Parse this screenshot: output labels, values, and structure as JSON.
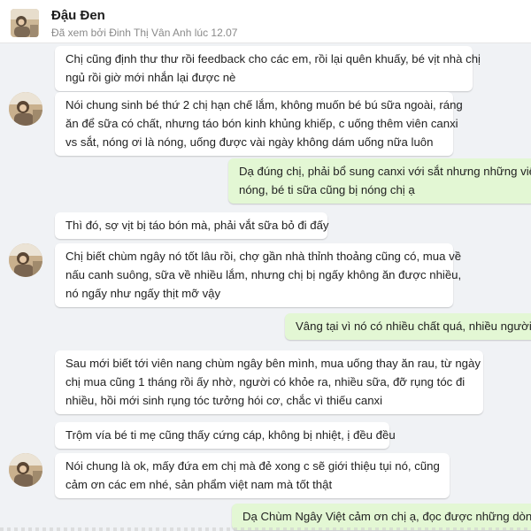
{
  "header": {
    "contact_name": "Đậu Đen",
    "seen_status": "Đã xem bởi Đinh Thị Vân Anh lúc 12.07"
  },
  "messages": [
    {
      "side": "in",
      "lines": [
        "Chị cũng định thư thư rồi feedback cho các em, rồi lại quên khuấy, bé vịt nhà chị",
        "ngủ rồi giờ mới nhắn lại được nè"
      ]
    },
    {
      "side": "in",
      "lines": [
        "Nói chung sinh bé thứ 2 chị hạn chế lắm, không muốn bé bú sữa ngoài, ráng",
        "ăn để sữa có chất, nhưng táo bón kinh khủng khiếp, c uống thêm viên canxi",
        "vs sắt, nóng ơi là nóng, uống được vài ngày không dám uống nữa luôn"
      ]
    },
    {
      "side": "out",
      "lines": [
        "Dạ đúng chị, phải bổ sung canxi với sắt nhưng những viên t",
        "nóng, bé ti sữa cũng bị nóng chị ạ"
      ]
    },
    {
      "side": "in",
      "lines": [
        "Thì đó, sợ vịt bị táo bón mà, phải vắt sữa bỏ đi đấy"
      ]
    },
    {
      "side": "in",
      "lines": [
        "Chị biết chùm ngây nó tốt lâu rồi, chợ gần nhà thỉnh thoảng cũng có, mua về",
        "nấu canh suông, sữa về nhiều lắm, nhưng chị bị ngấy không ăn được nhiều,",
        "nó ngấy như ngấy thịt mỡ vậy"
      ]
    },
    {
      "side": "out",
      "lines": [
        "Vâng tại vì nó có nhiều chất quá, nhiều người kê"
      ]
    },
    {
      "side": "in",
      "lines": [
        "Sau mới biết tới viên nang chùm ngây bên mình, mua uống thay ăn rau, từ ngày",
        "chị mua cũng 1 tháng rồi ấy nhờ, người có khỏe ra, nhiều sữa, đỡ rụng tóc đi",
        "nhiều, hồi mới sinh rụng tóc tưởng hói cơ, chắc vì thiếu canxi"
      ]
    },
    {
      "side": "in",
      "lines": [
        "Trộm vía bé ti mẹ cũng thấy cứng cáp, không bị nhiệt, ị đều đều"
      ]
    },
    {
      "side": "in",
      "lines": [
        "Nói chung là ok, mấy đứa em chị mà đẻ xong c sẽ giới thiệu tụi nó, cũng",
        "cảm ơn các em nhé, sản phẩm việt nam mà tốt thật"
      ]
    },
    {
      "side": "out",
      "lines": [
        "Dạ Chùm Ngây Việt cảm ơn chị ạ, đọc được những dòng nà"
      ]
    }
  ],
  "colors": {
    "background": "#f0f2f5",
    "incoming_bubble": "#ffffff",
    "outgoing_bubble": "#e3f7d4",
    "text": "#222222"
  },
  "icons": {
    "avatar": "contact-avatar-photo"
  }
}
